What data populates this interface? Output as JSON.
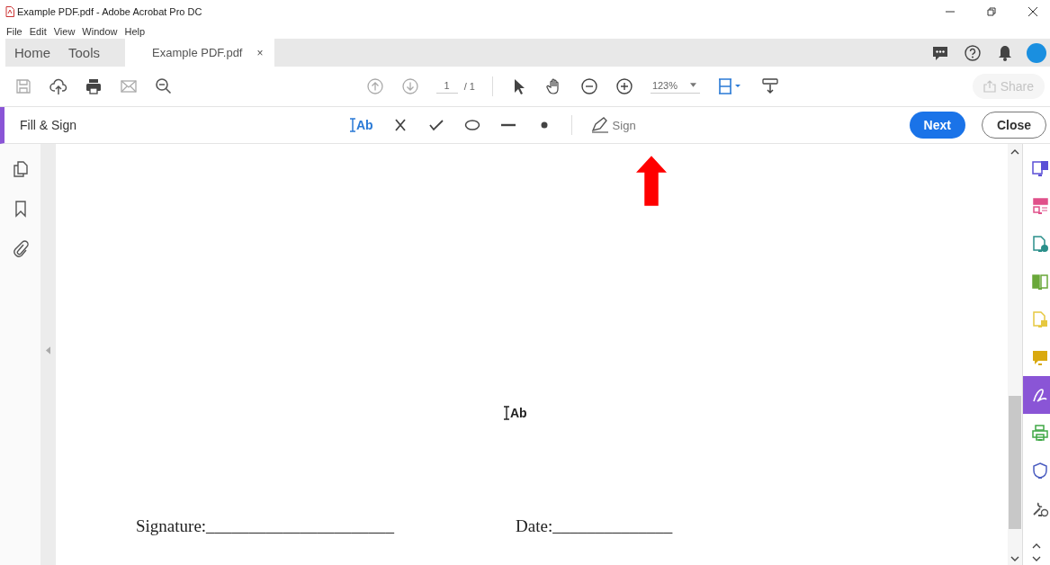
{
  "window": {
    "title": "Example PDF.pdf - Adobe Acrobat Pro DC"
  },
  "menu": [
    "File",
    "Edit",
    "View",
    "Window",
    "Help"
  ],
  "tabs": [
    {
      "label": "Home",
      "selected": false
    },
    {
      "label": "Tools",
      "selected": false
    },
    {
      "label": "Example PDF.pdf",
      "selected": true,
      "close_label": "×"
    }
  ],
  "toolbar": {
    "page": "1",
    "page_total": "/ 1",
    "zoom": "123%",
    "share": "Share",
    "share_disabled": true
  },
  "fill_sign": {
    "title": "Fill & Sign",
    "text_tool": "Ab",
    "sign": "Sign",
    "next": "Next",
    "close": "Close"
  },
  "document": {
    "cursor_label": "Ab",
    "signature": "Signature:______________________",
    "date": "Date:______________"
  },
  "tools_panel": [
    {
      "kind": "export",
      "color": "#5b4fd6",
      "selected": false
    },
    {
      "kind": "organize",
      "color": "#e0508a",
      "selected": false
    },
    {
      "kind": "create",
      "color": "#2a8f8a",
      "selected": false
    },
    {
      "kind": "combine",
      "color": "#6aa83a",
      "selected": false
    },
    {
      "kind": "edit",
      "color": "#e6c840",
      "selected": false
    },
    {
      "kind": "comment",
      "color": "#d9a90f",
      "selected": false
    },
    {
      "kind": "sign",
      "color": "#8a55d6",
      "selected": true
    },
    {
      "kind": "print",
      "color": "#3fa845",
      "selected": false
    },
    {
      "kind": "protect",
      "color": "#4a5cc0",
      "selected": false
    },
    {
      "kind": "more",
      "color": "#555555",
      "selected": false
    }
  ]
}
